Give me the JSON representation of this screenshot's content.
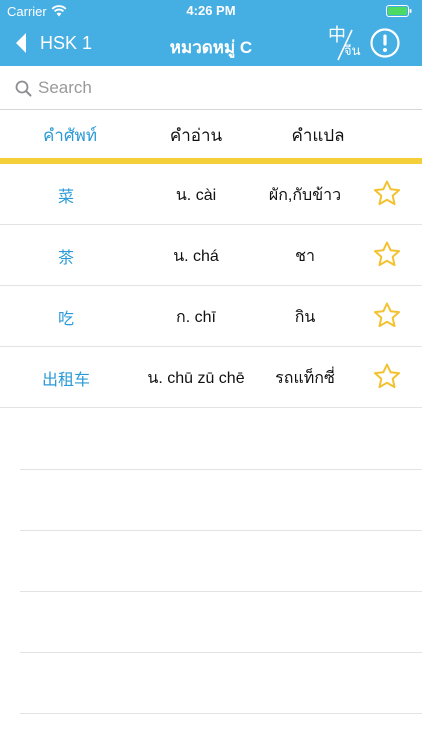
{
  "status_bar": {
    "carrier": "Carrier",
    "time": "4:26 PM",
    "wifi_icon": "wifi-icon",
    "battery_icon": "battery-icon"
  },
  "nav": {
    "back_label": "HSK 1",
    "title": "หมวดหมู่ C",
    "lang_toggle_zh": "中",
    "lang_toggle_th": "จีน",
    "back_icon": "chevron-left-icon",
    "info_icon": "info-circle-icon"
  },
  "search": {
    "placeholder": "Search",
    "value": ""
  },
  "columns": {
    "word": "คำศัพท์",
    "reading": "คำอ่าน",
    "meaning": "คำแปล"
  },
  "words": [
    {
      "word": "菜",
      "reading": "น. cài",
      "meaning": "ผัก,กับข้าว",
      "favorite": false
    },
    {
      "word": "茶",
      "reading": "น. chá",
      "meaning": "ชา",
      "favorite": false
    },
    {
      "word": "吃",
      "reading": "ก. chī",
      "meaning": "กิน",
      "favorite": false
    },
    {
      "word": "出租车",
      "reading": "น. chū zū chē",
      "meaning": "รถแท็กซี่",
      "favorite": false
    }
  ],
  "colors": {
    "header_bg": "#45aee2",
    "accent_blue": "#2b9ad6",
    "tab_underline": "#f5cf3a",
    "star_outline": "#f2c230"
  }
}
